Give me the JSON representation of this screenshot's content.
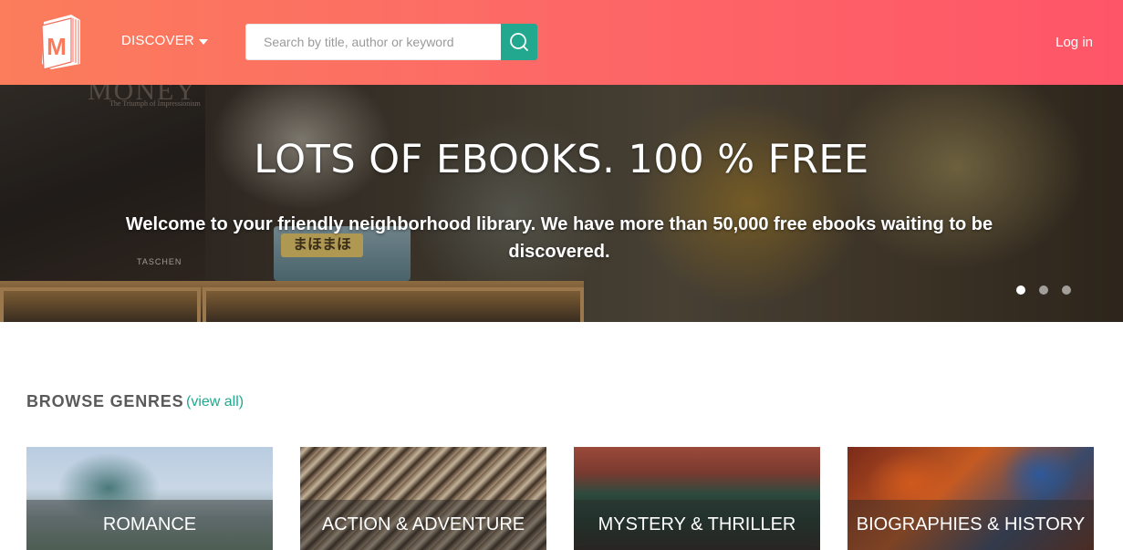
{
  "header": {
    "logo_letter": "M",
    "discover_label": "DISCOVER",
    "search_placeholder": "Search by title, author or keyword",
    "login_label": "Log in",
    "gradient_colors": [
      "#fb7d5b",
      "#fe5668"
    ],
    "search_button_color": "#22a88e"
  },
  "hero": {
    "title": "LOTS OF EBOOKS. 100 % FREE",
    "text": "Welcome to your friendly neighborhood library. We have more than 50,000 free ebooks waiting to be discovered.",
    "background_texts": {
      "book_title": "MONEY",
      "book_subtitle": "The Triumph of Impressionism",
      "publisher": "TASCHEN",
      "tin_label": "まほまほ"
    },
    "carousel": {
      "slides": 3,
      "active_index": 0
    }
  },
  "genres": {
    "title": "BROWSE GENRES",
    "view_all": "(view all)",
    "items": [
      {
        "label": "ROMANCE"
      },
      {
        "label": "ACTION & ADVENTURE"
      },
      {
        "label": "MYSTERY & THRILLER"
      },
      {
        "label": "BIOGRAPHIES & HISTORY"
      }
    ]
  },
  "colors": {
    "accent": "#22a88e"
  }
}
